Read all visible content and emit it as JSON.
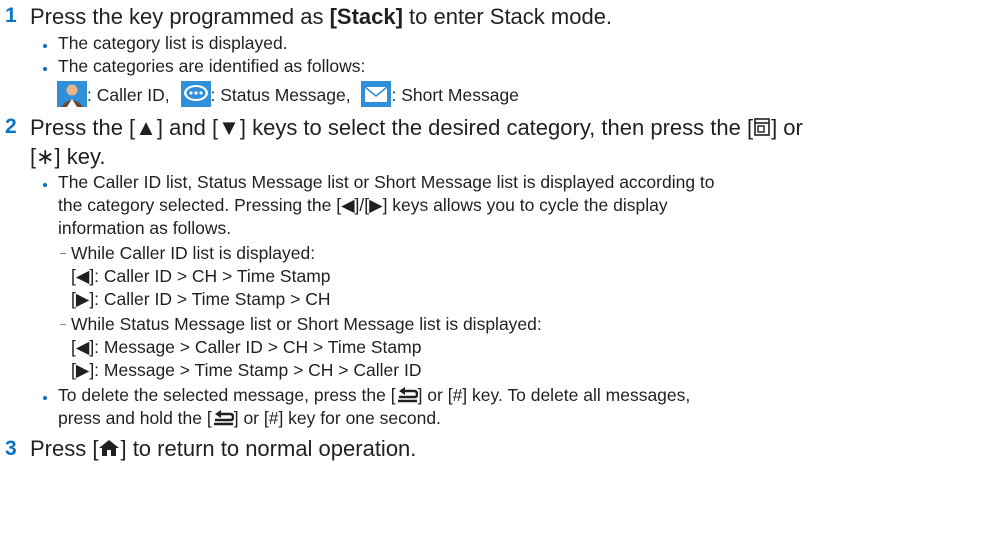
{
  "step1": {
    "num": "1",
    "pre": "Press the key programmed as ",
    "key": "[Stack]",
    "post": " to enter Stack mode.",
    "bullets": [
      "The category list is displayed.",
      "The categories are identified as follows:"
    ],
    "categories": [
      {
        "icon": "caller-id-icon",
        "label": ": Caller ID,"
      },
      {
        "icon": "status-message-icon",
        "label": ": Status Message,"
      },
      {
        "icon": "short-message-icon",
        "label": ": Short Message"
      }
    ]
  },
  "step2": {
    "num": "2",
    "line1": "Press the [▲] and [▼] keys to select the desired category, then press the [",
    "line1_end": "] or",
    "line2": "[∗] key.",
    "bullet1": [
      "The Caller ID list, Status Message list or Short Message list is displayed according to",
      "the category selected. Pressing the [◀]/[▶] keys allows you to cycle the display",
      "information as follows."
    ],
    "sub1_title": "While Caller ID list is displayed:",
    "sub1_items": [
      "[◀]: Caller ID > CH > Time Stamp",
      "[▶]: Caller ID > Time Stamp > CH"
    ],
    "sub2_title": "While Status Message list or Short Message list is displayed:",
    "sub2_items": [
      "[◀]: Message > Caller ID > CH > Time Stamp",
      "[▶]: Message > Time Stamp > CH > Caller ID"
    ],
    "bullet2_a": "To delete the selected message, press the [",
    "bullet2_b": "] or [#] key. To delete all messages,",
    "bullet2_c": "press and hold the [",
    "bullet2_d": "] or [#] key for one second."
  },
  "step3": {
    "num": "3",
    "pre": "Press [",
    "post": "] to return to normal operation."
  },
  "colors": {
    "accent": "#0a74c4",
    "text": "#231f20"
  }
}
